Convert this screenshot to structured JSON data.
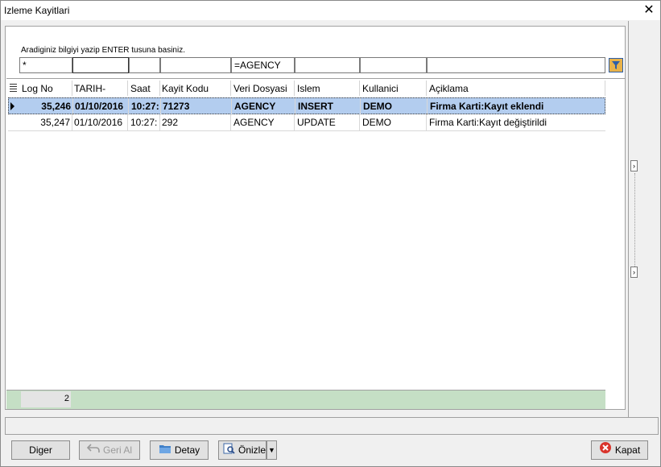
{
  "window": {
    "title": "Izleme Kayitlari",
    "close_glyph": "✕"
  },
  "search": {
    "hint": "Aradiginiz bilgiyi yazip ENTER tusuna basiniz.",
    "filters": [
      "*",
      "",
      "",
      "",
      "=AGENCY",
      "",
      "",
      ""
    ]
  },
  "grid": {
    "columns": [
      "Log No",
      "TARIH-",
      "Saat",
      "Kayit Kodu",
      "Veri Dosyasi",
      "Islem",
      "Kullanici",
      "Açiklama"
    ],
    "rows": [
      [
        "35,246",
        "01/10/2016",
        "10:27:",
        "71273",
        "AGENCY",
        "INSERT",
        "DEMO",
        "Firma Karti:Kayıt eklendi"
      ],
      [
        "35,247",
        "01/10/2016",
        "10:27:",
        "292",
        "AGENCY",
        "UPDATE",
        "DEMO",
        "Firma Karti:Kayıt değiştirildi"
      ]
    ],
    "footer_count": "2"
  },
  "buttons": {
    "diger": "Diger",
    "geri_al": "Geri Al",
    "detay": "Detay",
    "onizle": "Önizle",
    "kapat": "Kapat"
  },
  "colors": {
    "selected_row": "#b3cdef",
    "footer_bar": "#c5dfc5",
    "kapat_icon": "#d9342b"
  }
}
